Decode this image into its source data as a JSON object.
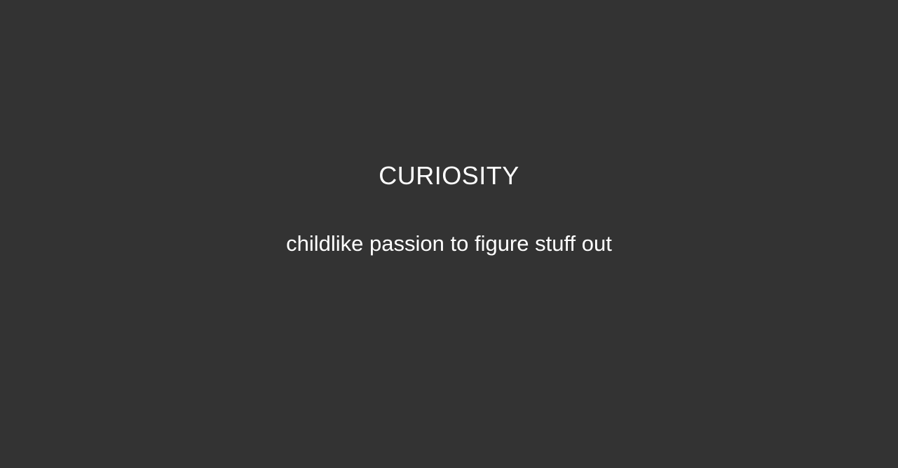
{
  "page": {
    "background_color": "#333333",
    "text_color": "#ffffff"
  },
  "slide": {
    "title": "CURIOSITY",
    "subtitle": "childlike passion to figure stuff out"
  }
}
